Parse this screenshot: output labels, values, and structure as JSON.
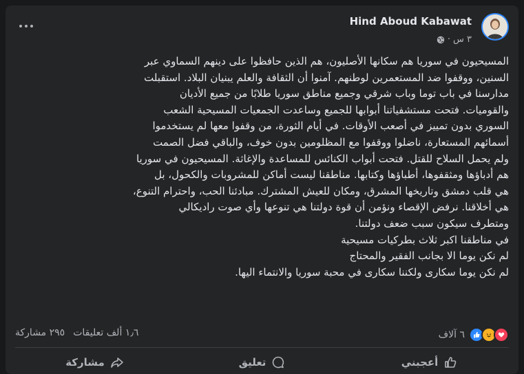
{
  "post": {
    "author": "Hind Aboud Kabawat",
    "time": "٣ س",
    "separator": "·",
    "privacy_icon": "globe-icon",
    "lines": [
      "المسيحيون في سوريا هم سكانها الأصليون، هم الذين حافظوا على دينهم السماوي عبر",
      "السنين، ووقفوا ضد المستعمرين لوطنهم. آمنوا أن الثقافة والعلم يبنيان البلاد. استقبلت",
      "مدارسنا في باب توما وباب شرقي وجميع مناطق سوريا طلابًا من جميع الأديان",
      "والقوميات. فتحت مستشفياتنا أبوابها للجميع وساعدت الجمعيات المسيحية الشعب",
      "السوري بدون تمييز في أصعب الأوقات. في أيام الثورة، من وقفوا معها لم يستخدموا",
      "أسمائهم المستعارة، ناضلوا ووقفوا مع المظلومين بدون خوف، والباقي فضل الصمت",
      "ولم يحمل السلاح للقتل. فتحت أبواب الكنائس للمساعدة والإغاثة. المسيحيون في سوريا",
      "هم أدباؤها ومثقفوها، أطباؤها وكتابها. مناطقنا ليست أماكن للمشروبات والكحول، بل",
      "هي قلب دمشق وتاريخها المشرق، ومكان للعيش المشترك. مبادئنا الحب، واحترام التنوع،",
      "هي أخلاقنا. نرفض الإقصاء ونؤمن أن قوة دولتنا هي تنوعها وأي صوت راديكالي",
      "ومتطرف سيكون سبب ضعف دولتنا.",
      "في مناطقنا اكبر ثلاث بطركيات مسيحية",
      "لم نكن يوما الا بجانب الفقير والمحتاج",
      "لم نكن يوما سكارى ولكننا سكارى في محبة سوريا والانتماء اليها."
    ]
  },
  "stats": {
    "reactions_count": "٦ آلاف",
    "reaction_icons": [
      "like-icon",
      "haha-icon",
      "love-icon"
    ],
    "comments": "١٫٦ ألف تعليقات",
    "shares": "٢٩٥ مشاركة"
  },
  "actions": {
    "like": "أعجبني",
    "comment": "تعليق",
    "share": "مشاركة"
  },
  "colors": {
    "background": "#18191a",
    "card": "#242526",
    "text": "#e4e6eb",
    "secondary": "#b0b3b8",
    "like_blue": "#2d88ff",
    "love_red": "#f33e58",
    "haha_yellow": "#f7b125"
  }
}
